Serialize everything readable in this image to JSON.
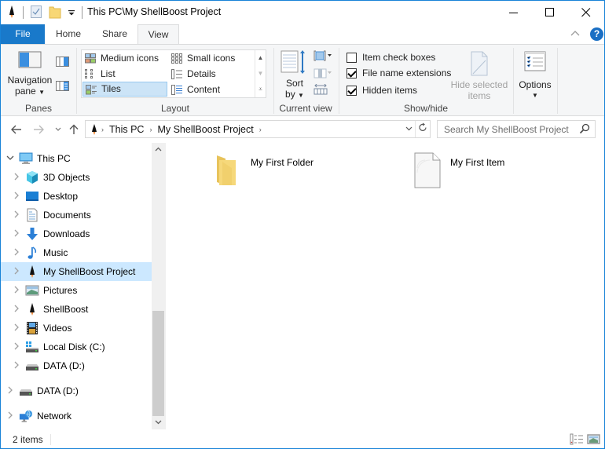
{
  "window": {
    "title": "This PC\\My ShellBoost Project",
    "controls": {
      "minimize": "minimize",
      "maximize": "maximize",
      "close": "close"
    }
  },
  "quick_access": {
    "icons": [
      "shellboost-rocket-icon",
      "properties-icon",
      "new-folder-icon",
      "customize-dropdown-icon"
    ]
  },
  "ribbon": {
    "tabs": [
      {
        "label": "File",
        "active": false
      },
      {
        "label": "Home",
        "active": false
      },
      {
        "label": "Share",
        "active": false
      },
      {
        "label": "View",
        "active": true
      }
    ],
    "help_label": "?",
    "groups": {
      "panes": {
        "label": "Panes",
        "navigation_pane_line1": "Navigation",
        "navigation_pane_line2": "pane"
      },
      "layout": {
        "label": "Layout",
        "items": [
          {
            "label": "Medium icons",
            "selected": false
          },
          {
            "label": "Small icons",
            "selected": false
          },
          {
            "label": "List",
            "selected": false
          },
          {
            "label": "Details",
            "selected": false
          },
          {
            "label": "Tiles",
            "selected": true
          },
          {
            "label": "Content",
            "selected": false
          }
        ]
      },
      "current_view": {
        "label": "Current view",
        "sort_line1": "Sort",
        "sort_line2": "by"
      },
      "show_hide": {
        "label": "Show/hide",
        "checkboxes": [
          {
            "label": "Item check boxes",
            "checked": false
          },
          {
            "label": "File name extensions",
            "checked": true
          },
          {
            "label": "Hidden items",
            "checked": true
          }
        ],
        "hide_selected_line1": "Hide selected",
        "hide_selected_line2": "items"
      },
      "options": {
        "label": "Options"
      }
    }
  },
  "address_bar": {
    "breadcrumbs": [
      "This PC",
      "My ShellBoost Project"
    ],
    "search_placeholder": "Search My ShellBoost Project"
  },
  "nav_pane": {
    "items": [
      {
        "label": "This PC",
        "icon": "this-pc-icon",
        "level": 0,
        "expanded": true,
        "selected": false
      },
      {
        "label": "3D Objects",
        "icon": "3d-objects-icon",
        "level": 1,
        "expanded": false,
        "selected": false
      },
      {
        "label": "Desktop",
        "icon": "desktop-icon",
        "level": 1,
        "expanded": false,
        "selected": false
      },
      {
        "label": "Documents",
        "icon": "documents-icon",
        "level": 1,
        "expanded": false,
        "selected": false
      },
      {
        "label": "Downloads",
        "icon": "downloads-icon",
        "level": 1,
        "expanded": false,
        "selected": false
      },
      {
        "label": "Music",
        "icon": "music-icon",
        "level": 1,
        "expanded": false,
        "selected": false
      },
      {
        "label": "My ShellBoost Project",
        "icon": "shellboost-rocket-icon",
        "level": 1,
        "expanded": false,
        "selected": true
      },
      {
        "label": "Pictures",
        "icon": "pictures-icon",
        "level": 1,
        "expanded": false,
        "selected": false
      },
      {
        "label": "ShellBoost",
        "icon": "shellboost-rocket-icon",
        "level": 1,
        "expanded": false,
        "selected": false
      },
      {
        "label": "Videos",
        "icon": "videos-icon",
        "level": 1,
        "expanded": false,
        "selected": false
      },
      {
        "label": "Local Disk (C:)",
        "icon": "local-disk-icon",
        "level": 1,
        "expanded": false,
        "selected": false
      },
      {
        "label": "DATA (D:)",
        "icon": "drive-icon",
        "level": 1,
        "expanded": false,
        "selected": false
      },
      {
        "label": "DATA (D:)",
        "icon": "drive-icon",
        "level": 0,
        "expanded": false,
        "selected": false
      },
      {
        "label": "Network",
        "icon": "network-icon",
        "level": 0,
        "expanded": false,
        "selected": false
      }
    ]
  },
  "content": {
    "items": [
      {
        "label": "My First Folder",
        "type": "folder"
      },
      {
        "label": "My First Item",
        "type": "file"
      }
    ]
  },
  "status_bar": {
    "item_count": "2 items"
  },
  "colors": {
    "accent": "#1979ca",
    "selection": "#cce8ff",
    "border": "#1883d7"
  }
}
